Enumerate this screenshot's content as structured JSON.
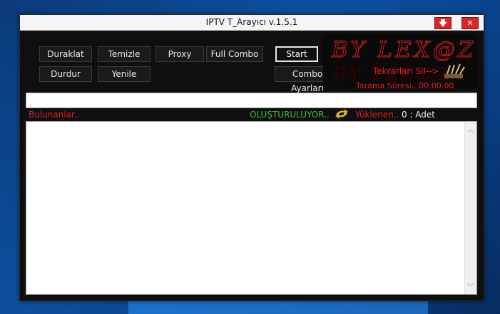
{
  "window": {
    "title": "IPTV  T_Arayıcı v.1.5.1",
    "minimize_glyph": "🡇",
    "close_glyph": "✕"
  },
  "buttons": {
    "duraklat": "Duraklat",
    "temizle": "Temizle",
    "proxy": "Proxy",
    "full_combo": "Full Combo",
    "start": "Start",
    "durdur": "Durdur",
    "yenile": "Yenile",
    "combo_ayarlari": "Combo Ayarları"
  },
  "banner": {
    "logo_text": "BY LEX@Z",
    "tekrarlari_sil": "Tekrarları Sil-->",
    "tarama_suresi": "Tarama Süresi..  00:00:00"
  },
  "status": {
    "bulunanlar": "Bulunanlar..",
    "olusturuluyor": "OLUŞTURULUYOR..",
    "yuklenen": "Yüklenen..",
    "count": "0 : Adet"
  },
  "colors": {
    "accent_red": "#e31f1f",
    "status_green": "#38c238",
    "window_bg": "#0f0f0f"
  }
}
